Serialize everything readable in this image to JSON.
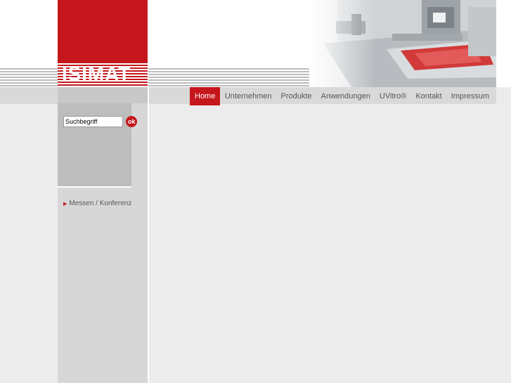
{
  "brand": {
    "logo_text": "ISIMAT",
    "accent_color": "#c4161c"
  },
  "nav": {
    "items": [
      {
        "label": "Home",
        "active": true
      },
      {
        "label": "Unternehmen",
        "active": false
      },
      {
        "label": "Produkte",
        "active": false
      },
      {
        "label": "Anwendungen",
        "active": false
      },
      {
        "label": "UVitro®",
        "active": false
      },
      {
        "label": "Kontakt",
        "active": false
      },
      {
        "label": "Impressum",
        "active": false
      }
    ]
  },
  "search": {
    "value": "Suchbegriff",
    "go_label": "ok",
    "icon": "go-icon"
  },
  "sidebar": {
    "links": [
      {
        "label": "Messen / Konferenzen",
        "icon": "triangle-right-icon"
      }
    ]
  },
  "header": {
    "image": "screen-printing-machine-photo"
  }
}
